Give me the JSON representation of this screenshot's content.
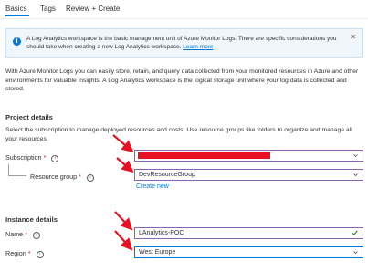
{
  "tabs": [
    "Basics",
    "Tags",
    "Review + Create"
  ],
  "info_banner": {
    "text": "A Log Analytics workspace is the basic management unit of Azure Monitor Logs. There are specific considerations you should take when creating a new Log Analytics workspace.",
    "link": "Learn more"
  },
  "intro": "With Azure Monitor Logs you can easily store, retain, and query data collected from your monitored resources in Azure and other environments for valuable insights. A Log Analytics workspace is the logical storage unit where your log data is collected and stored.",
  "project": {
    "heading": "Project details",
    "description": "Select the subscription to manage deployed resources and costs. Use resource groups like folders to organize and manage all your resources.",
    "subscription_label": "Subscription",
    "subscription_value": "",
    "resource_group_label": "Resource group",
    "resource_group_value": "DevResourceGroup",
    "create_new": "Create new"
  },
  "instance": {
    "heading": "Instance details",
    "name_label": "Name",
    "name_value": "LAnalytics-POC",
    "region_label": "Region",
    "region_value": "West Europe"
  },
  "required_marker": "*",
  "help_glyph": "i",
  "colors": {
    "accent": "#0078d4",
    "annotation_arrow": "#e81123",
    "focus_border": "#8764b8",
    "redaction": "#e81123",
    "required": "#a4262c",
    "valid_check": "#107c10"
  },
  "icons": [
    "info-icon",
    "close-icon",
    "info-circle-icon",
    "chevron-down-icon",
    "checkmark-icon",
    "annotation-arrow"
  ]
}
